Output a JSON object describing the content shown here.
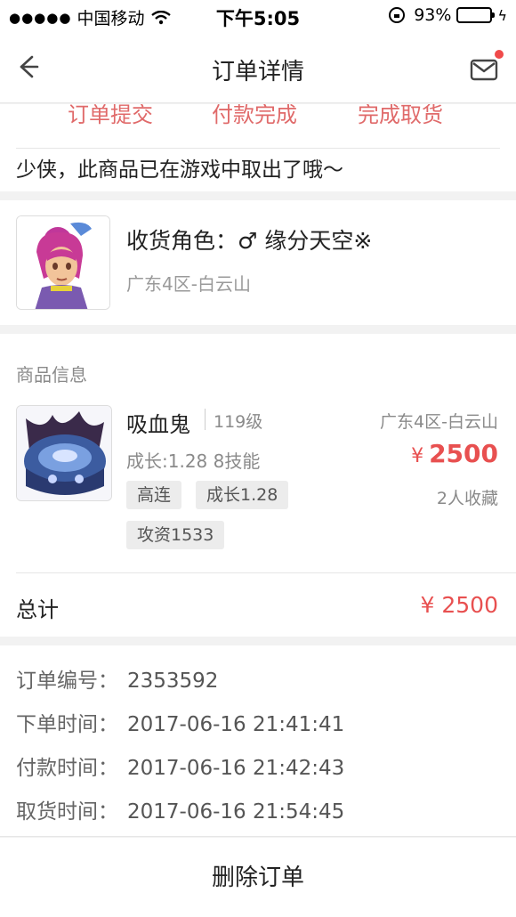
{
  "status_bar": {
    "carrier": "中国移动",
    "time": "下午5:05",
    "battery": "93%",
    "battery_level": 0.93,
    "battery_color": "#3fd34b"
  },
  "nav": {
    "title": "订单详情",
    "back_icon": "back-arrow-icon",
    "message_icon": "mail-icon",
    "badge_color": "#f04a4a"
  },
  "steps": [
    "订单提交",
    "付款完成",
    "完成取货"
  ],
  "notice": "少侠，此商品已在游戏中取出了哦～",
  "role": {
    "name": "收货角色：♂ 缘分天空※",
    "server": "广东4区-白云山"
  },
  "goods": {
    "header": "商品信息",
    "name": "吸血鬼",
    "level": "119级",
    "server": "广东4区-白云山",
    "growth_skills": "成长:1.28 8技能",
    "price_symbol": "¥",
    "price": "2500",
    "favorites": "2人收藏",
    "tags": [
      "高连",
      "成长1.28",
      "攻资1533"
    ],
    "price_color": "#e85050"
  },
  "total": {
    "label": "总计",
    "value": "¥ 2500"
  },
  "order_info": [
    {
      "key": "订单编号：",
      "value": "2353592"
    },
    {
      "key": "下单时间：",
      "value": "2017-06-16 21:41:41"
    },
    {
      "key": "付款时间：",
      "value": "2017-06-16 21:42:43"
    },
    {
      "key": "取货时间：",
      "value": "2017-06-16 21:54:45"
    }
  ],
  "action": {
    "delete_label": "删除订单"
  }
}
